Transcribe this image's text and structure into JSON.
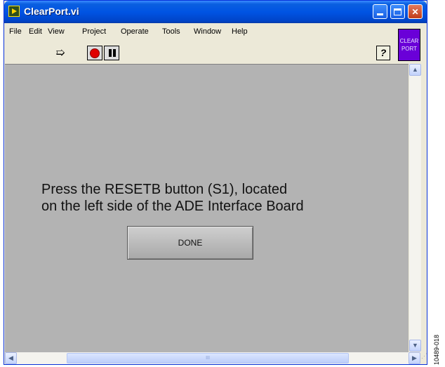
{
  "window": {
    "title": "ClearPort.vi"
  },
  "menu": [
    "File",
    "Edit",
    "View",
    "Project",
    "Operate",
    "Tools",
    "Window",
    "Help"
  ],
  "toolbar": {
    "help_label": "?"
  },
  "vi_icon": {
    "line1": "CLEAR",
    "line2": "PORT"
  },
  "panel": {
    "message_line1": "Press the RESETB button (S1), located",
    "message_line2": "on the left side of the ADE Interface Board",
    "done_label": "DONE"
  },
  "scrollbar": {
    "thumb_grip": "III"
  },
  "figure_id": "10489-018",
  "colors": {
    "title_blue": "#0054e3",
    "panel_gray": "#b3b3b3",
    "vi_icon_purple": "#6a00d8",
    "stop_red": "#e00000"
  }
}
